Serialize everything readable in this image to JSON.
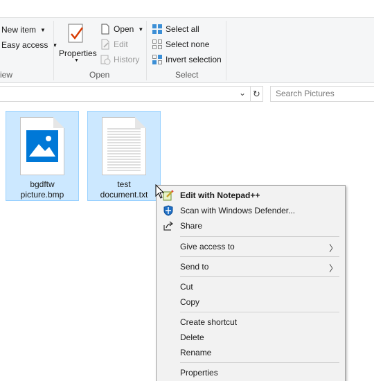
{
  "ribbon": {
    "new_group": {
      "new_item": "New item",
      "easy_access": "Easy access",
      "label_partial": "iew"
    },
    "open_group": {
      "properties": "Properties",
      "open": "Open",
      "edit": "Edit",
      "history": "History",
      "label": "Open"
    },
    "select_group": {
      "select_all": "Select all",
      "select_none": "Select none",
      "invert_selection": "Invert selection",
      "label": "Select"
    }
  },
  "address_bar": {
    "search_placeholder": "Search Pictures",
    "refresh_glyph": "↻",
    "dropdown_glyph": "⌄"
  },
  "files": [
    {
      "name_line1": "bgdftw",
      "name_line2": "picture.bmp",
      "icon": "image-file-icon"
    },
    {
      "name_line1": "test",
      "name_line2": "document.txt",
      "icon": "text-file-icon"
    }
  ],
  "context_menu": {
    "items": [
      {
        "label": "Edit with Notepad++",
        "bold": true,
        "icon": "notepadpp-icon"
      },
      {
        "label": "Scan with Windows Defender...",
        "icon": "defender-icon"
      },
      {
        "label": "Share",
        "icon": "share-icon"
      },
      {
        "label": "Give access to",
        "submenu": true
      },
      {
        "label": "Send to",
        "submenu": true
      },
      {
        "label": "Cut"
      },
      {
        "label": "Copy"
      },
      {
        "label": "Create shortcut"
      },
      {
        "label": "Delete"
      },
      {
        "label": "Rename"
      },
      {
        "label": "Properties"
      }
    ],
    "submenu_glyph": "〉"
  },
  "colors": {
    "selection_bg": "#cce8ff",
    "selection_border": "#99d1ff",
    "accent_blue": "#0078d7",
    "ribbon_bg": "#f5f6f7",
    "menu_bg": "#f2f2f2"
  }
}
